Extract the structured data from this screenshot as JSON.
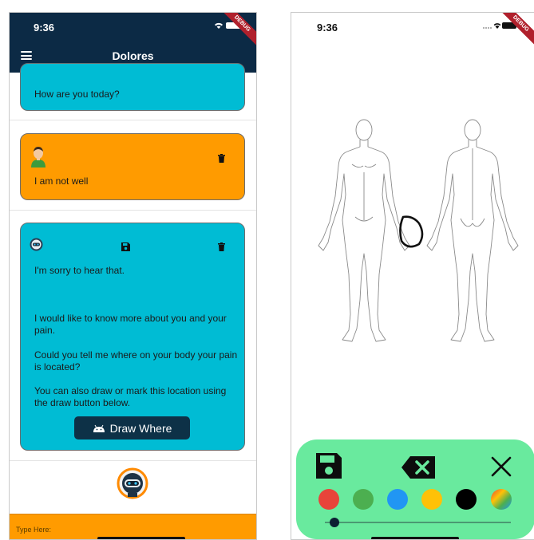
{
  "left_phone": {
    "status": {
      "time": "9:36",
      "debug_label": "DEBUG"
    },
    "appbar": {
      "title": "Dolores"
    },
    "messages": [
      {
        "sender": "bot",
        "text": "How are you today?"
      },
      {
        "sender": "user",
        "text": "I am not well"
      },
      {
        "sender": "bot",
        "paragraphs": [
          "I'm sorry to hear that.",
          "I would like to know more about you and your pain.",
          "Could you tell me where on your body your pain is located?",
          "You can also draw or mark this location using the draw button below."
        ]
      }
    ],
    "draw_button_label": "Draw Where",
    "input": {
      "placeholder": "Type Here:"
    },
    "colors": {
      "appbar": "#0c2a45",
      "bot_bubble": "#00bcd4",
      "user_bubble": "#ff9b00",
      "button": "#0d3147"
    }
  },
  "right_phone": {
    "status": {
      "time": "9:36",
      "debug_label": "DEBUG"
    },
    "toolbar": {
      "icons": [
        "save-icon",
        "backspace-clear-icon",
        "close-icon"
      ],
      "swatches": [
        {
          "name": "red",
          "color": "#e8443a"
        },
        {
          "name": "green",
          "color": "#4caf50"
        },
        {
          "name": "blue",
          "color": "#2196f3"
        },
        {
          "name": "yellow",
          "color": "#ffc107"
        },
        {
          "name": "black",
          "color": "#000000"
        },
        {
          "name": "gradient",
          "color": "multicolor"
        }
      ],
      "stroke_slider_value": 0.05,
      "background": "#69ea9e"
    }
  }
}
